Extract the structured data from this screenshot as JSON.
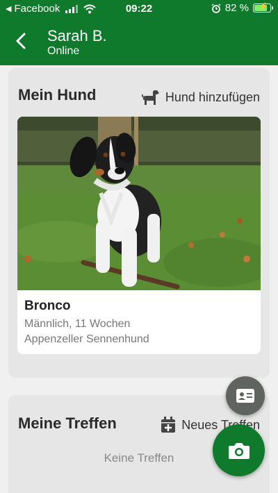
{
  "status_bar": {
    "back_app": "Facebook",
    "time": "09:22",
    "battery": "82 %",
    "battery_level": 0.82,
    "icons": [
      "back-arrow-icon",
      "signal-icon",
      "wifi-icon",
      "alarm-icon",
      "battery-charging-icon"
    ]
  },
  "header": {
    "name": "Sarah B.",
    "status": "Online"
  },
  "dog_section": {
    "title": "Mein Hund",
    "add_label": "Hund hinzufügen",
    "dog": {
      "name": "Bronco",
      "details": "Männlich, 11 Wochen",
      "breed": "Appenzeller Sennenhund"
    }
  },
  "meet_section": {
    "title": "Meine Treffen",
    "add_label": "Neues Treffen",
    "empty_text": "Keine Treffen"
  },
  "colors": {
    "primary": "#0f7a2c",
    "card": "#e6e6e6",
    "background": "#f0f0f0",
    "fab_secondary": "#5f6460"
  }
}
